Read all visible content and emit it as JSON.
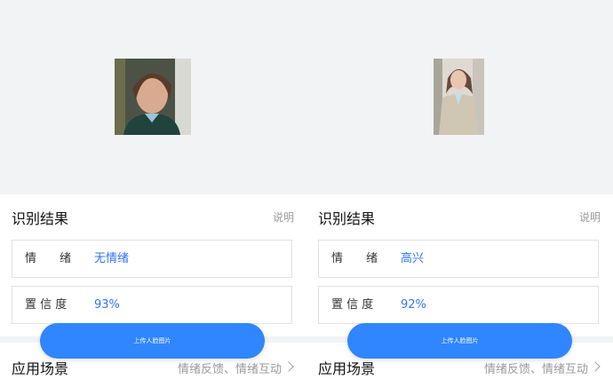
{
  "panels": [
    {
      "result_title": "识别结果",
      "help_link": "说明",
      "rows": [
        {
          "label": "情　　绪",
          "value": "无情绪"
        },
        {
          "label": "置 信 度",
          "value": "93%"
        }
      ],
      "upload_button": "上传人脸图片",
      "scenario_title": "应用场景",
      "scenario_tags": "情绪反馈、情绪互动"
    },
    {
      "result_title": "识别结果",
      "help_link": "说明",
      "rows": [
        {
          "label": "情　　绪",
          "value": "高兴"
        },
        {
          "label": "置 信 度",
          "value": "92%"
        }
      ],
      "upload_button": "上传人脸图片",
      "scenario_title": "应用场景",
      "scenario_tags": "情绪反馈、情绪互动"
    }
  ],
  "colors": {
    "accent": "#2f86ff",
    "value_text": "#2f74ff",
    "muted_text": "#9a9a9a",
    "background": "#f2f3f5"
  }
}
